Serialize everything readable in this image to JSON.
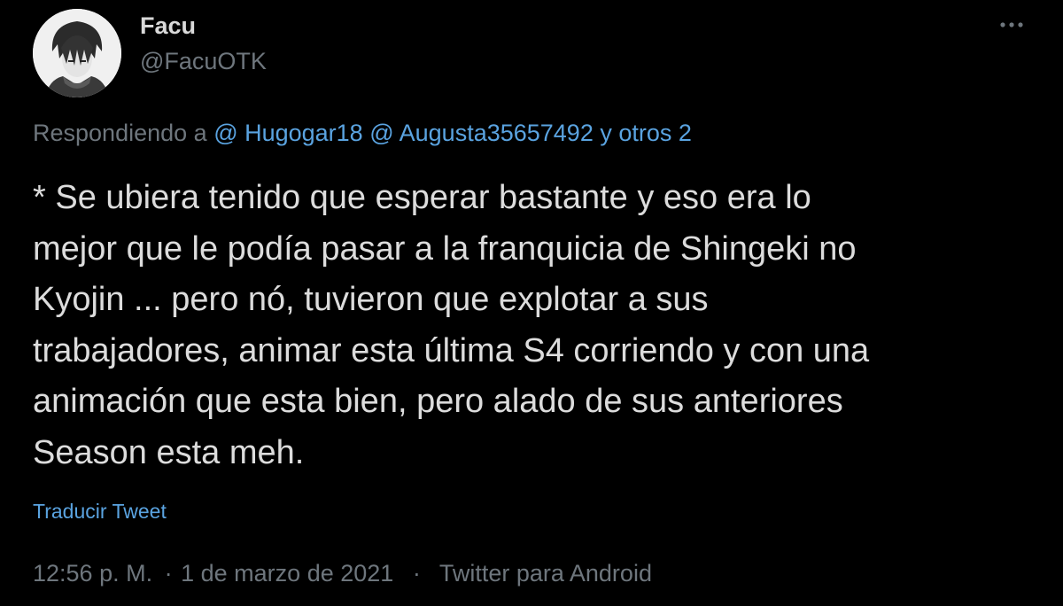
{
  "author": {
    "name": "Facu",
    "handle": "@FacuOTK"
  },
  "reply": {
    "prefix": "Respondiendo a",
    "mentions": [
      "@ Hugogar18",
      "@ Augusta35657492",
      "y otros 2"
    ]
  },
  "tweet": {
    "lines": [
      "* Se ubiera tenido que esperar bastante y eso era lo",
      "mejor que le podía pasar a la franquicia de Shingeki no",
      "Kyojin ... pero nó, tuvieron que explotar a sus",
      "trabajadores, animar esta última S4 corriendo y con una",
      "animación que esta bien, pero alado de sus anteriores",
      "Season esta meh."
    ]
  },
  "translate_label": "Traducir Tweet",
  "meta": {
    "time": "12:56 p. M.",
    "separator1": "·",
    "date": "1 de marzo de 2021",
    "separator2": "·",
    "source": "Twitter para Android"
  },
  "icons": {
    "more": "more-horizontal-icon"
  },
  "colors": {
    "background": "#000000",
    "text": "#d9d9d9",
    "secondary": "#6e767d",
    "link": "#5aa3e0"
  }
}
